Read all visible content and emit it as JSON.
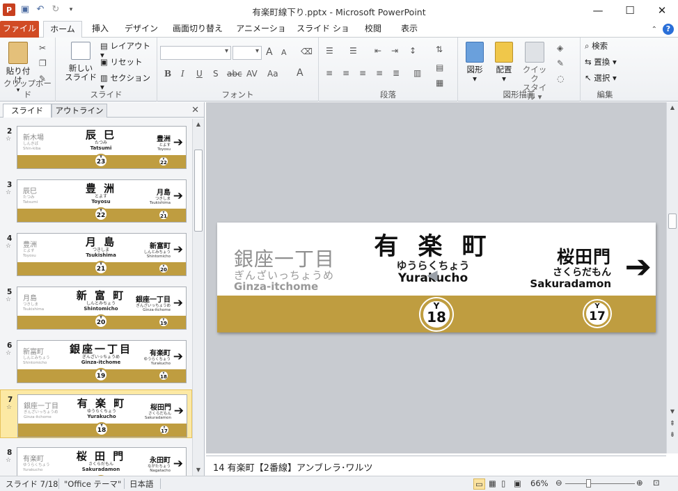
{
  "window": {
    "title": "有楽町線下り.pptx - Microsoft PowerPoint",
    "min": "—",
    "max": "☐",
    "close": "✕"
  },
  "qat": {
    "logo": "P"
  },
  "tabs": [
    "ファイル",
    "ホーム",
    "挿入",
    "デザイン",
    "画面切り替え",
    "アニメーション",
    "スライド ショー",
    "校閲",
    "表示"
  ],
  "ribbon": {
    "clipboard": {
      "paste": "貼り付け",
      "label": "クリップボード"
    },
    "slides": {
      "new_slide": "新しい",
      "new_slide2": "スライド",
      "layout": "レイアウト",
      "reset": "リセット",
      "section": "セクション",
      "label": "スライド"
    },
    "font": {
      "label": "フォント",
      "bold": "B",
      "italic": "I",
      "underline": "U",
      "shadow": "S",
      "strike": "abc",
      "spacing": "AV",
      "case": "Aa",
      "color": "A",
      "grow": "A",
      "shrink": "A"
    },
    "paragraph": {
      "label": "段落"
    },
    "drawing": {
      "shapes": "図形",
      "arrange": "配置",
      "quick": "クイック",
      "quick2": "スタイル",
      "label": "図形描画"
    },
    "editing": {
      "find": "検索",
      "replace": "置換",
      "select": "選択",
      "label": "編集"
    }
  },
  "panel": {
    "tab_slides": "スライド",
    "tab_outline": "アウトライン",
    "close": "✕"
  },
  "thumbnails": [
    {
      "num": "2",
      "prev": "新木場",
      "prev_kana": "しんきば",
      "prev_rom": "Shin-kiba",
      "cur": "辰 巳",
      "cur_kana": "たつみ",
      "cur_rom": "Tatsumi",
      "next": "豊洲",
      "next_kana": "とよす",
      "next_rom": "Toyosu",
      "c1": "23",
      "c2": "22"
    },
    {
      "num": "3",
      "prev": "辰巳",
      "prev_kana": "たつみ",
      "prev_rom": "Tatsumi",
      "cur": "豊 洲",
      "cur_kana": "とよす",
      "cur_rom": "Toyosu",
      "next": "月島",
      "next_kana": "つきしま",
      "next_rom": "Tsukishima",
      "c1": "22",
      "c2": "21"
    },
    {
      "num": "4",
      "prev": "豊洲",
      "prev_kana": "とよす",
      "prev_rom": "Toyosu",
      "cur": "月 島",
      "cur_kana": "つきしま",
      "cur_rom": "Tsukishima",
      "next": "新富町",
      "next_kana": "しんとみちょう",
      "next_rom": "Shintomicho",
      "c1": "21",
      "c2": "20"
    },
    {
      "num": "5",
      "prev": "月島",
      "prev_kana": "つきしま",
      "prev_rom": "Tsukishima",
      "cur": "新 富 町",
      "cur_kana": "しんとみちょう",
      "cur_rom": "Shintomicho",
      "next": "銀座一丁目",
      "next_kana": "ぎんざいっちょうめ",
      "next_rom": "Ginza-itchome",
      "c1": "20",
      "c2": "19"
    },
    {
      "num": "6",
      "prev": "新富町",
      "prev_kana": "しんとみちょう",
      "prev_rom": "Shintomicho",
      "cur": "銀座一丁目",
      "cur_kana": "ぎんざいっちょうめ",
      "cur_rom": "Ginza-itchome",
      "next": "有楽町",
      "next_kana": "ゆうらくちょう",
      "next_rom": "Yurakucho",
      "c1": "19",
      "c2": "18"
    },
    {
      "num": "7",
      "prev": "銀座一丁目",
      "prev_kana": "ぎんざいっちょうめ",
      "prev_rom": "Ginza-itchome",
      "cur": "有 楽 町",
      "cur_kana": "ゆうらくちょう",
      "cur_rom": "Yurakucho",
      "next": "桜田門",
      "next_kana": "さくらだもん",
      "next_rom": "Sakuradamon",
      "c1": "18",
      "c2": "17"
    },
    {
      "num": "8",
      "prev": "有楽町",
      "prev_kana": "ゆうらくちょう",
      "prev_rom": "Yurakucho",
      "cur": "桜 田 門",
      "cur_kana": "さくらだもん",
      "cur_rom": "Sakuradamon",
      "next": "永田町",
      "next_kana": "ながたちょう",
      "next_rom": "Nagatacho",
      "c1": "17",
      "c2": "16"
    }
  ],
  "main_slide": {
    "prev": "銀座一丁目",
    "prev_kana": "ぎんざいっちょうめ",
    "prev_rom": "Ginza-itchome",
    "cur": "有 楽 町",
    "cur_kana": "ゆうらくちょう",
    "cur_rom": "Yurakucho",
    "next": "桜田門",
    "next_kana": "さくらだもん",
    "next_rom": "Sakuradamon",
    "arrow": "➔",
    "line_letter": "Y",
    "cur_num": "18",
    "next_num": "17",
    "band_color": "#bf9d40"
  },
  "notes": {
    "text": "14 有楽町【2番線】アンブレラ･ワルツ"
  },
  "status": {
    "slide": "スライド 7/18",
    "theme": "\"Office テーマ\"",
    "lang": "日本語",
    "zoom": "66%"
  }
}
